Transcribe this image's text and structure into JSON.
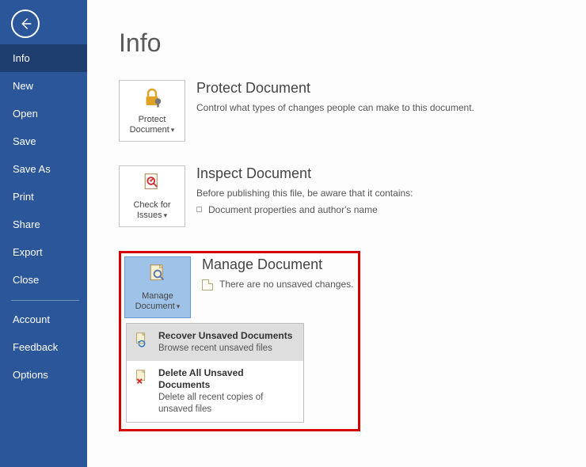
{
  "sidebar": {
    "items": [
      {
        "label": "Info",
        "selected": true
      },
      {
        "label": "New"
      },
      {
        "label": "Open"
      },
      {
        "label": "Save"
      },
      {
        "label": "Save As"
      },
      {
        "label": "Print"
      },
      {
        "label": "Share"
      },
      {
        "label": "Export"
      },
      {
        "label": "Close"
      }
    ],
    "bottom_items": [
      {
        "label": "Account"
      },
      {
        "label": "Feedback"
      },
      {
        "label": "Options"
      }
    ]
  },
  "page": {
    "title": "Info"
  },
  "protect": {
    "tile_label": "Protect Document",
    "heading": "Protect Document",
    "text": "Control what types of changes people can make to this document."
  },
  "inspect": {
    "tile_label": "Check for Issues",
    "heading": "Inspect Document",
    "text_intro": "Before publishing this file, be aware that it contains:",
    "bullets": [
      "Document properties and author's name"
    ]
  },
  "manage": {
    "tile_label": "Manage Document",
    "heading": "Manage Document",
    "status_text": "There are no unsaved changes.",
    "menu": [
      {
        "title": "Recover Unsaved Documents",
        "sub": "Browse recent unsaved files"
      },
      {
        "title": "Delete All Unsaved Documents",
        "sub": "Delete all recent copies of unsaved files"
      }
    ]
  },
  "colors": {
    "brand": "#2b579a",
    "highlight": "#d50000"
  }
}
